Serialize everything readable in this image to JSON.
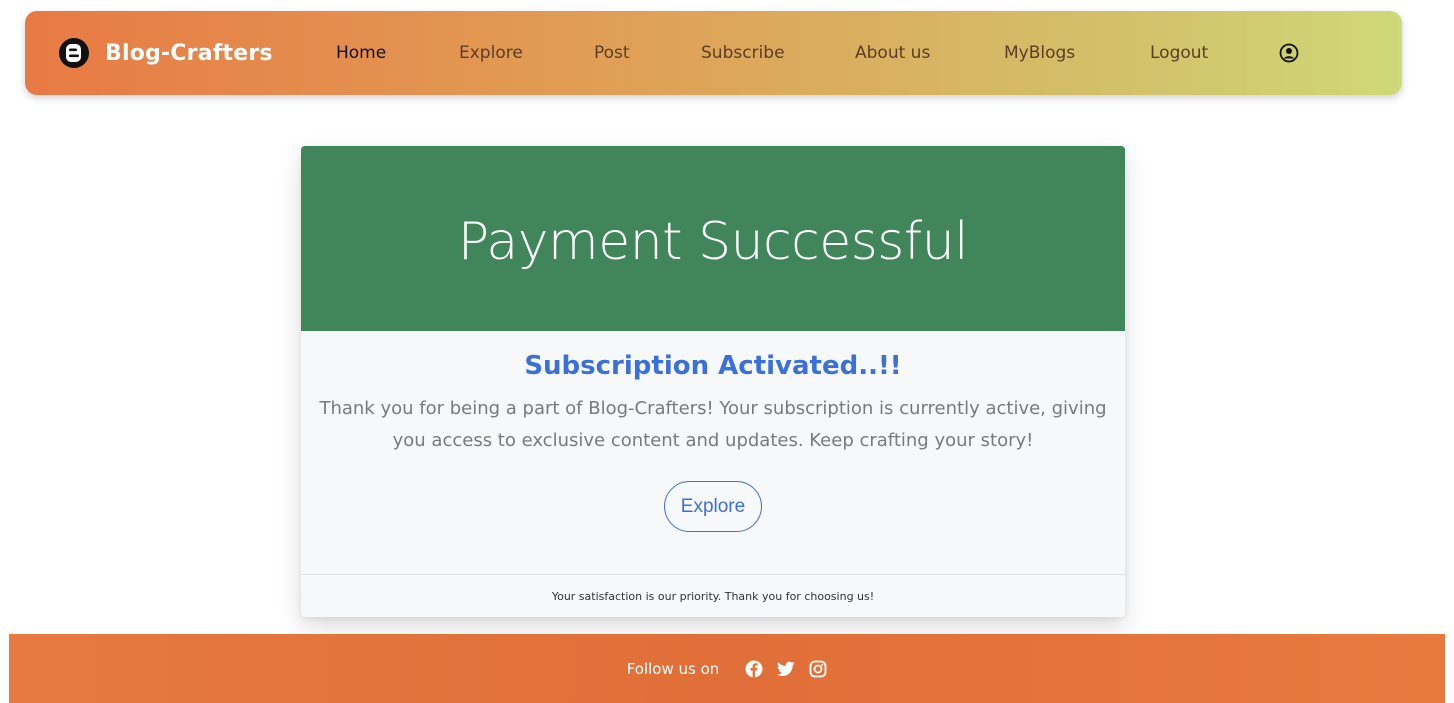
{
  "navbar": {
    "brand": "Blog-Crafters",
    "brand_icon": "blogger-logo-icon",
    "items": [
      {
        "label": "Home",
        "active": true
      },
      {
        "label": "Explore"
      },
      {
        "label": "Post"
      },
      {
        "label": "Subscribe"
      },
      {
        "label": "About us"
      },
      {
        "label": "MyBlogs"
      },
      {
        "label": "Logout"
      }
    ],
    "user_icon": "user-circle-icon"
  },
  "card": {
    "title": "Payment Successful",
    "subheading": "Subscription Activated..!!",
    "message": "Thank you for being a part of Blog-Crafters! Your subscription is currently active, giving you access to exclusive content and updates. Keep crafting your story!",
    "button_label": "Explore",
    "footer": "Your satisfaction is our priority. Thank you for choosing us!"
  },
  "footer": {
    "follow_text": "Follow us on",
    "social_icons": [
      "facebook-icon",
      "twitter-icon",
      "instagram-icon"
    ]
  },
  "colors": {
    "header_green": "#41865a",
    "accent_blue": "#3b6fd9",
    "footer_orange": "#e67a40"
  }
}
